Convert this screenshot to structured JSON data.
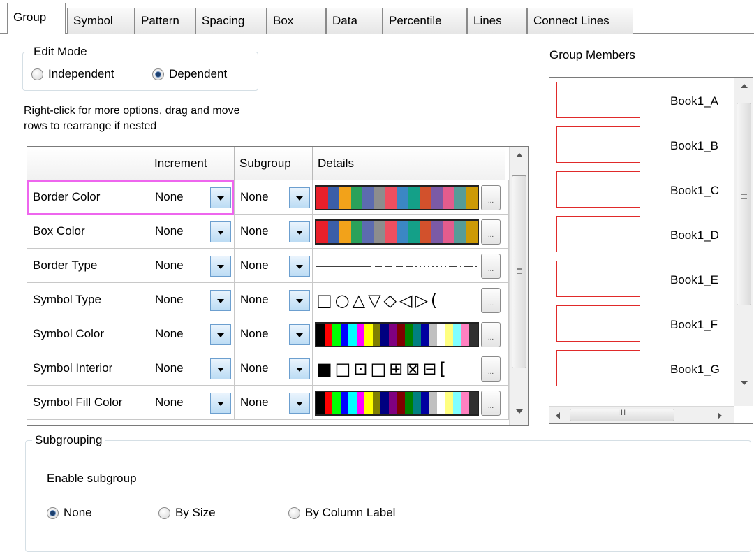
{
  "tabs": [
    {
      "label": "Group",
      "active": true
    },
    {
      "label": "Symbol"
    },
    {
      "label": "Pattern"
    },
    {
      "label": "Spacing"
    },
    {
      "label": "Box"
    },
    {
      "label": "Data"
    },
    {
      "label": "Percentile"
    },
    {
      "label": "Lines"
    },
    {
      "label": "Connect Lines"
    }
  ],
  "edit_mode": {
    "legend": "Edit Mode",
    "options": [
      {
        "label": "Independent",
        "checked": false
      },
      {
        "label": "Dependent",
        "checked": true
      }
    ]
  },
  "hint": {
    "line1": "Right-click for more options, drag and move",
    "line2": "rows to  rearrange if nested"
  },
  "grid": {
    "columns": [
      "",
      "Increment",
      "Subgroup",
      "Details"
    ],
    "rows": [
      {
        "name": "Border Color",
        "increment": "None",
        "subgroup": "None",
        "details_kind": "colors1"
      },
      {
        "name": "Box Color",
        "increment": "None",
        "subgroup": "None",
        "details_kind": "colors1"
      },
      {
        "name": "Border Type",
        "increment": "None",
        "subgroup": "None",
        "details_kind": "linetypes"
      },
      {
        "name": "Symbol Type",
        "increment": "None",
        "subgroup": "None",
        "details_kind": "symbols"
      },
      {
        "name": "Symbol Color",
        "increment": "None",
        "subgroup": "None",
        "details_kind": "colors2"
      },
      {
        "name": "Symbol Interior",
        "increment": "None",
        "subgroup": "None",
        "details_kind": "interiors"
      },
      {
        "name": "Symbol Fill Color",
        "increment": "None",
        "subgroup": "None",
        "details_kind": "colors2"
      }
    ],
    "focused_row": "Border Color",
    "ellipsis": "..."
  },
  "details_palettes": {
    "colors1": [
      "#e8202a",
      "#3a5ea8",
      "#f2a21a",
      "#2aa15a",
      "#5c6bb0",
      "#8d8d8d",
      "#ee4f60",
      "#3b87c4",
      "#14a088",
      "#d2512c",
      "#7b5aa6",
      "#e35c8d",
      "#569c98",
      "#cc9a06"
    ],
    "colors2": [
      "#000000",
      "#ff0000",
      "#00ff00",
      "#0000ff",
      "#00ffff",
      "#ff00ff",
      "#ffff00",
      "#808000",
      "#000080",
      "#800080",
      "#800000",
      "#008000",
      "#008080",
      "#0000a0",
      "#c0c0c0",
      "#ffffff",
      "#ffff80",
      "#80ffff",
      "#ff80c0",
      "#303030"
    ],
    "symbols": [
      "□",
      "○",
      "△",
      "▽",
      "◇",
      "◁",
      "▷",
      "("
    ],
    "interiors": [
      "■",
      "□",
      "⊡",
      "□",
      "⊞",
      "⊠",
      "⊟",
      "["
    ]
  },
  "group_members": {
    "title": "Group Members",
    "items": [
      "Book1_A",
      "Book1_B",
      "Book1_C",
      "Book1_D",
      "Book1_E",
      "Book1_F",
      "Book1_G"
    ]
  },
  "subgrouping": {
    "legend": "Subgrouping",
    "enable_label": "Enable subgroup",
    "options": [
      {
        "label": "None",
        "checked": true
      },
      {
        "label": "By Size",
        "checked": false
      },
      {
        "label": "By Column Label",
        "checked": false
      }
    ]
  },
  "scroll_glyphs": {
    "grip": "≡",
    "thumb_lines": "III"
  }
}
